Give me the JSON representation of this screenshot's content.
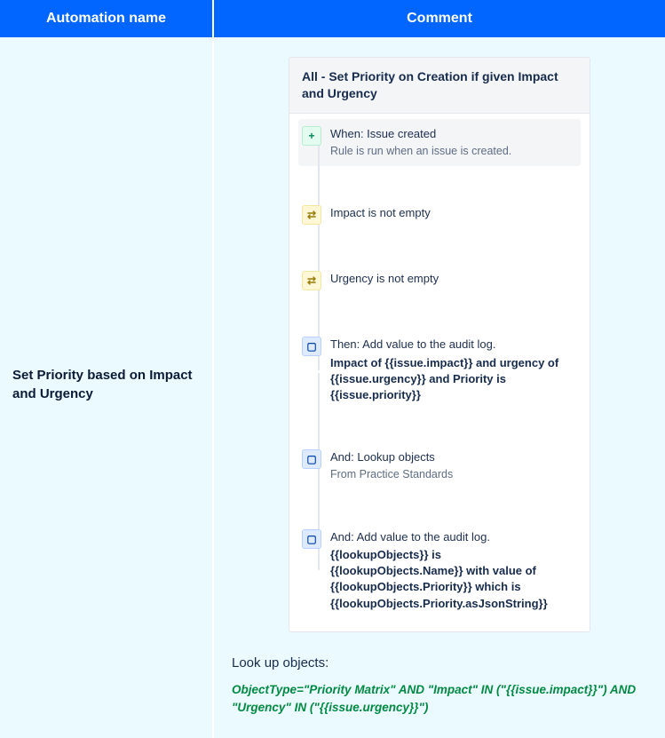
{
  "table": {
    "headers": {
      "name": "Automation name",
      "comment": "Comment"
    },
    "row": {
      "name": "Set Priority based on Impact and Urgency"
    }
  },
  "rule": {
    "title": "All - Set Priority on Creation if given Impact and Urgency",
    "steps": {
      "trigger": {
        "title": "When: Issue created",
        "subtitle": "Rule is run when an issue is created."
      },
      "cond1": {
        "title": "Impact is not empty"
      },
      "cond2": {
        "title": "Urgency is not empty"
      },
      "action1": {
        "title": "Then: Add value to the audit log.",
        "body": "Impact of {{issue.impact}} and urgency of {{issue.urgency}} and Priority is {{issue.priority}}"
      },
      "action2": {
        "title": "And: Lookup objects",
        "subtitle": "From Practice Standards"
      },
      "action3": {
        "title": "And: Add value to the audit log.",
        "body": "{{lookupObjects}} is {{lookupObjects.Name}} with value of {{lookupObjects.Priority}} which is {{lookupObjects.Priority.asJsonString}}"
      }
    }
  },
  "lookup": {
    "heading": "Look up objects:",
    "query": "ObjectType=\"Priority Matrix\" AND \"Impact\" IN (\"{{issue.impact}}\") AND \"Urgency\" IN (\"{{issue.urgency}}\")"
  },
  "icons": {
    "plus": "+",
    "shuffle": "⇄",
    "clipboard": "▢"
  }
}
